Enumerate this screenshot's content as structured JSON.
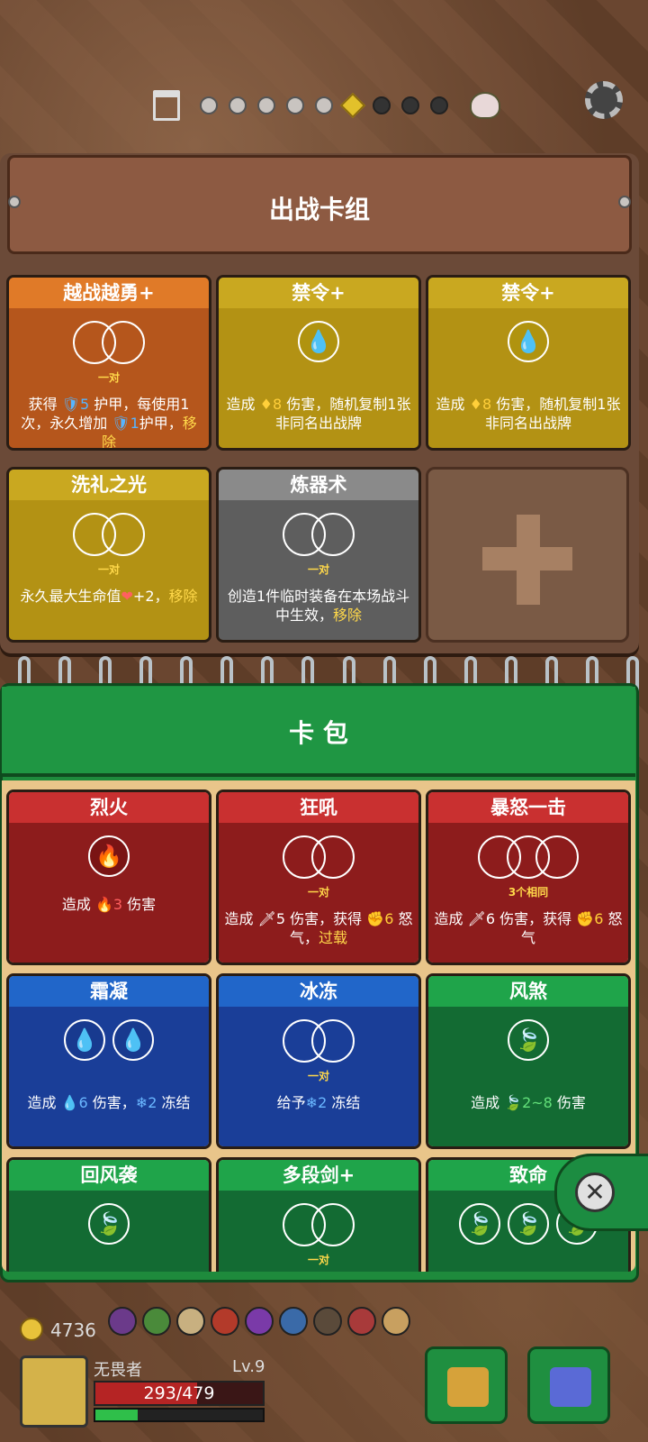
{
  "deck": {
    "title": "出战卡组",
    "cards": [
      {
        "name": "越战越勇+",
        "color": "orange",
        "sub": "一对",
        "desc_parts": [
          "获得 ",
          "🛡5",
          " 护甲，每使用1次，永久增加 ",
          "🛡1",
          "护甲，",
          "移除"
        ]
      },
      {
        "name": "禁令+",
        "color": "gold",
        "desc_parts": [
          "造成 ",
          "♦8",
          " 伤害，随机复制1张非同名出战牌"
        ]
      },
      {
        "name": "禁令+",
        "color": "gold",
        "desc_parts": [
          "造成 ",
          "♦8",
          " 伤害，随机复制1张非同名出战牌"
        ]
      },
      {
        "name": "洗礼之光",
        "color": "gold",
        "sub": "一对",
        "desc_parts": [
          "永久最大生命值",
          "❤",
          "+2，",
          "移除"
        ]
      },
      {
        "name": "炼器术",
        "color": "grey",
        "sub": "一对",
        "desc_parts": [
          "创造1件临时装备在本场战斗中生效，",
          "移除"
        ]
      }
    ]
  },
  "pack": {
    "title": "卡 包",
    "cards": [
      {
        "name": "烈火",
        "color": "red",
        "desc_parts": [
          "造成 ",
          "🔥3",
          " 伤害"
        ]
      },
      {
        "name": "狂吼",
        "color": "red",
        "sub": "一对",
        "desc_parts": [
          "造成 ",
          "🗡5",
          " 伤害，获得 ",
          "✊6",
          " 怒气，",
          "过载"
        ]
      },
      {
        "name": "暴怒一击",
        "color": "red",
        "sub": "3个相同",
        "desc_parts": [
          "造成 ",
          "🗡6",
          " 伤害，获得 ",
          "✊6",
          " 怒气"
        ]
      },
      {
        "name": "霜凝",
        "color": "blue",
        "desc_parts": [
          "造成 ",
          "💧6",
          " 伤害，",
          "❄2",
          " 冻结"
        ]
      },
      {
        "name": "冰冻",
        "color": "blue",
        "sub": "一对",
        "desc_parts": [
          "给予",
          "❄2",
          " 冻结"
        ]
      },
      {
        "name": "风煞",
        "color": "green",
        "desc_parts": [
          "造成 ",
          "🍃2~8",
          " 伤害"
        ]
      },
      {
        "name": "回风袭",
        "color": "green"
      },
      {
        "name": "多段剑+",
        "color": "green",
        "sub": "一对"
      },
      {
        "name": "致命",
        "color": "green"
      }
    ]
  },
  "player": {
    "coins": "4736",
    "name": "无畏者",
    "level": "Lv.9",
    "hp": "293/479",
    "hp_fraction": 0.61,
    "xp_fraction": 0.25
  }
}
